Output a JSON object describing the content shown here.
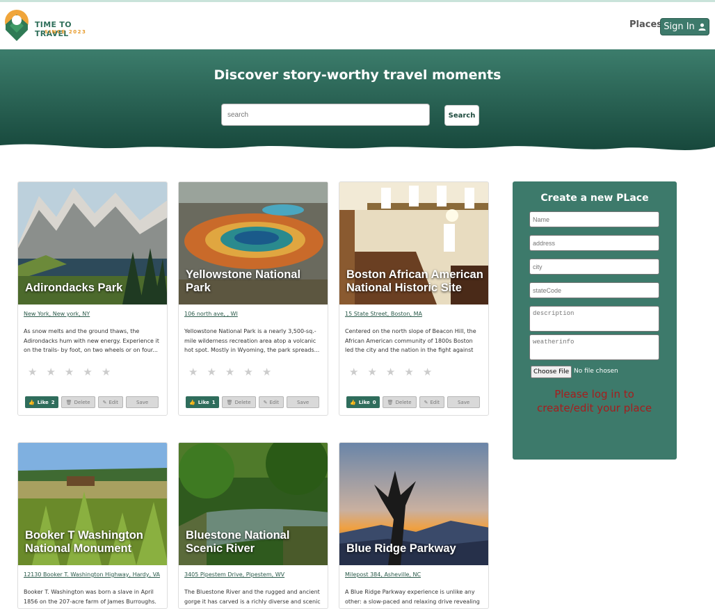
{
  "header": {
    "logo_line1": "TIME TO TRAVEL",
    "logo_line2": "SINCE 2023",
    "nav_places": "Places",
    "signin_label": "Sign In"
  },
  "hero": {
    "title": "Discover story-worthy travel moments",
    "search_placeholder": "search",
    "search_button": "Search"
  },
  "cards": [
    {
      "title": "Adirondacks Park",
      "address": "New York, New york, NY",
      "description": "As snow melts and the ground thaws, the Adirondacks hum with new energy. Experience it on the trails- by foot, on two wheels or on four...",
      "likes": "2"
    },
    {
      "title": "Yellowstone National Park",
      "address": "106 north ave, , WI",
      "description": "Yellowstone National Park is a nearly 3,500-sq.-mile wilderness recreation area atop a volcanic hot spot. Mostly in Wyoming, the park spreads...",
      "likes": "1"
    },
    {
      "title": "Boston African American National Historic Site",
      "address": "15 State Street, Boston, MA",
      "description": "Centered on the north slope of Beacon Hill, the African American community of 1800s Boston led the city and the nation in the fight against slave...",
      "likes": "0"
    },
    {
      "title": "Booker T Washington National Monument",
      "address": "12130 Booker T. Washington Highway, Hardy, VA",
      "description": "Booker T. Washington was born a slave in April 1856 on the 207-acre farm of James Burroughs."
    },
    {
      "title": "Bluestone National Scenic River",
      "address": "3405 Pipestem Drive, Pipestem, WV",
      "description": "The Bluestone River and the rugged and ancient gorge it has carved is a richly diverse and scenic"
    },
    {
      "title": "Blue Ridge Parkway",
      "address": "Milepost 384, Asheville, NC",
      "description": "A Blue Ridge Parkway experience is unlike any other: a slow-paced and relaxing drive revealing"
    }
  ],
  "card_buttons": {
    "like": "Like",
    "delete": "Delete",
    "edit": "Edit",
    "save": "Save"
  },
  "rating": {
    "stars_filled": 0,
    "stars_total": 5
  },
  "sidebar": {
    "title": "Create a new PLace",
    "name_placeholder": "Name",
    "address_placeholder": "address",
    "city_placeholder": "city",
    "state_placeholder": "stateCode",
    "description_placeholder": "description",
    "weather_placeholder": "weatherinfo",
    "choose_file": "Choose File",
    "no_file": "No file chosen",
    "login_message": "Please log in to create/edit your place"
  },
  "colors": {
    "brand_green": "#3d7a6b",
    "hero_green": "#235a4b",
    "error_red": "#a61d1d"
  }
}
